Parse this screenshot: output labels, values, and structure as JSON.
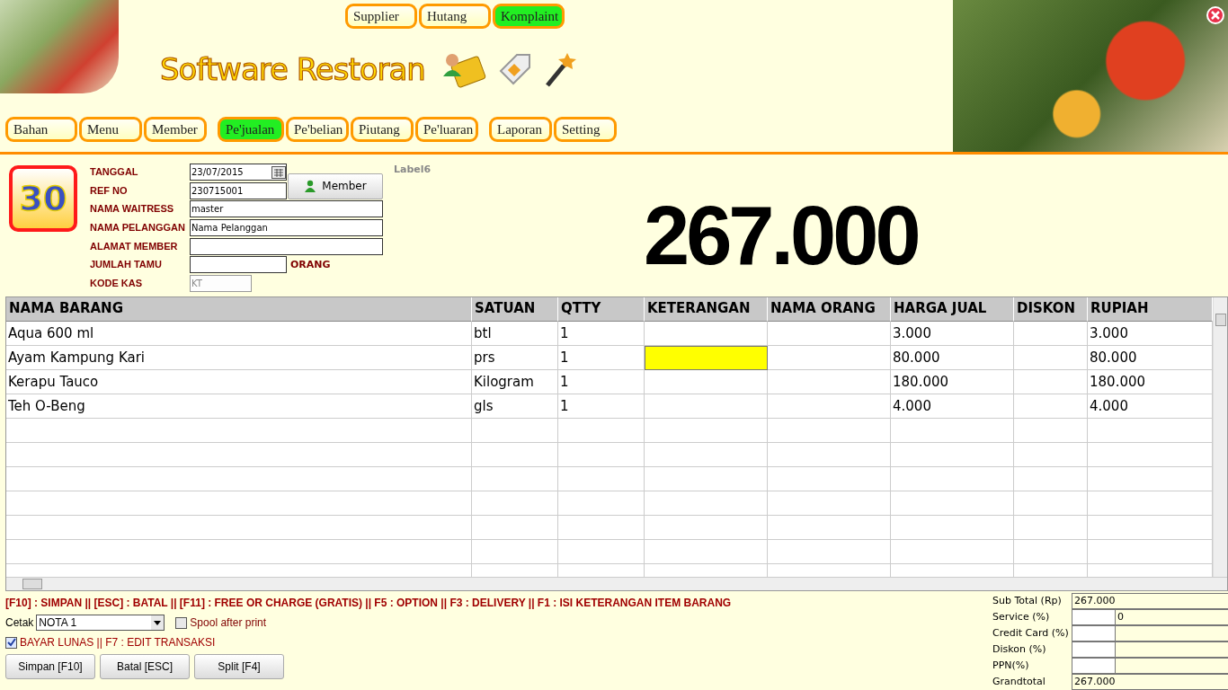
{
  "header": {
    "logo": "Software Restoran",
    "top_tabs": [
      {
        "label": "Supplier",
        "selected": false
      },
      {
        "label": "Hutang",
        "selected": false
      },
      {
        "label": "Komplaint",
        "selected": true
      }
    ],
    "nav_tabs": [
      {
        "label": "Bahan",
        "selected": false
      },
      {
        "label": "Menu",
        "selected": false
      },
      {
        "label": "Member",
        "selected": false
      },
      {
        "label": "Pe'jualan",
        "selected": true
      },
      {
        "label": "Pe'belian",
        "selected": false
      },
      {
        "label": "Piutang",
        "selected": false
      },
      {
        "label": "Pe'luaran",
        "selected": false
      },
      {
        "label": "Laporan",
        "selected": false
      },
      {
        "label": "Setting",
        "selected": false
      }
    ]
  },
  "badge": "30",
  "form": {
    "fields": [
      {
        "label": "TANGGAL",
        "value": "23/07/2015",
        "kind": "date",
        "disabled": false
      },
      {
        "label": "REF NO",
        "value": "230715001",
        "kind": "short",
        "disabled": false
      },
      {
        "label": "NAMA WAITRESS",
        "value": "master",
        "kind": "wide",
        "disabled": false
      },
      {
        "label": "NAMA PELANGGAN",
        "value": "Nama Pelanggan",
        "kind": "wide",
        "disabled": false
      },
      {
        "label": "ALAMAT MEMBER",
        "kind": "wide",
        "disabled": false
      },
      {
        "label": "JUMLAH TAMU",
        "kind": "short",
        "suffix": "ORANG",
        "disabled": false
      },
      {
        "label": "KODE KAS",
        "value": "KT",
        "kind": "tiny",
        "disabled": true
      }
    ],
    "member_button": "Member"
  },
  "label6": "Label6",
  "total": "267.000",
  "table": {
    "columns": [
      "NAMA BARANG",
      "SATUAN",
      "QTTY",
      "KETERANGAN",
      "NAMA ORANG",
      "HARGA JUAL",
      "DISKON",
      "RUPIAH"
    ],
    "rows": [
      {
        "cells": [
          "Aqua 600 ml",
          "btl",
          "1",
          "",
          "",
          "3.000",
          "",
          "3.000"
        ],
        "highlighted_cell": false
      },
      {
        "cells": [
          "Ayam Kampung Kari",
          "prs",
          "1",
          "",
          "",
          "80.000",
          "",
          "80.000"
        ],
        "highlighted_cell": true
      },
      {
        "cells": [
          "Kerapu Tauco",
          "Kilogram",
          "1",
          "",
          "",
          "180.000",
          "",
          "180.000"
        ],
        "highlighted_cell": false
      },
      {
        "cells": [
          "Teh O-Beng",
          "gls",
          "1",
          "",
          "",
          "4.000",
          "",
          "4.000"
        ],
        "highlighted_cell": false
      }
    ]
  },
  "footer": {
    "shortcuts": "[F10] : SIMPAN  ||  [ESC] : BATAL || [F11]  : FREE OR CHARGE (GRATIS) || F5 : OPTION || F3 : DELIVERY || F1 : ISI KETERANGAN ITEM BARANG",
    "print_label": "Cetak",
    "print_value": "NOTA 1",
    "spool": {
      "label": "Spool after print",
      "checked": false
    },
    "paid": {
      "label": "BAYAR LUNAS || F7 : EDIT TRANSAKSI",
      "checked": true
    },
    "buttons": [
      "Simpan [F10]",
      "Batal [ESC]",
      "Split [F4]"
    ]
  },
  "summary": [
    {
      "label": "Sub Total (Rp)",
      "value": "267.000",
      "kind": "single"
    },
    {
      "label": "Service (%)",
      "value": "0",
      "kind": "split"
    },
    {
      "label": "Credit Card (%)",
      "kind": "split"
    },
    {
      "label": "Diskon (%)",
      "kind": "split"
    },
    {
      "label": "PPN(%)",
      "kind": "split"
    },
    {
      "label": "Grandtotal",
      "value": "267.000",
      "kind": "single"
    }
  ]
}
